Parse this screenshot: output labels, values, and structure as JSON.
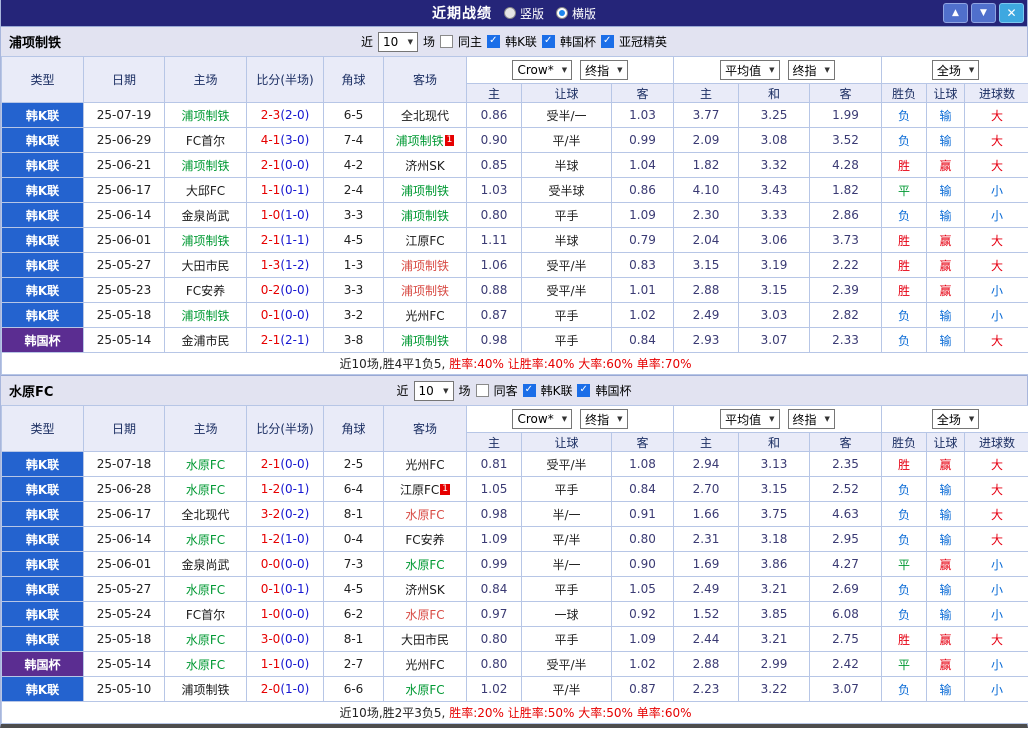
{
  "titlebar": {
    "title": "近期战绩",
    "radio_vertical": "竖版",
    "radio_horizontal": "横版",
    "up": "▲",
    "down": "▼",
    "close": "✕"
  },
  "columns": {
    "type": "类型",
    "date": "日期",
    "home": "主场",
    "score": "比分(半场)",
    "corner": "角球",
    "away": "客场",
    "sub": [
      "主",
      "让球",
      "客",
      "主",
      "和",
      "客",
      "胜负",
      "让球",
      "进球数"
    ]
  },
  "colors": {
    "accent_blue": "#2463cf",
    "cup_purple": "#5b2d91",
    "win_red": "#e60012",
    "loss_blue": "#0a6bd6",
    "draw_green": "#009933",
    "team_green": "#009933",
    "titlebar": "#252579"
  },
  "sections": [
    {
      "team": "浦项制铁",
      "filter": {
        "near": "近",
        "games": "10",
        "unit": "场",
        "same_label": "同主",
        "same_checked": false,
        "leagues": [
          {
            "label": "韩K联",
            "checked": true
          },
          {
            "label": "韩国杯",
            "checked": true
          },
          {
            "label": "亚冠精英",
            "checked": true
          }
        ]
      },
      "selects": {
        "bookmaker": "Crow*",
        "ah_index": "终指",
        "euro": "平均值",
        "euro_index": "终指",
        "scope": "全场"
      },
      "rows": [
        {
          "lg": "韩K联",
          "cup": false,
          "d": "25-07-19",
          "h": "浦项制铁",
          "hc": "green",
          "hcard": false,
          "s": "2-3",
          "hf": "(2-0)",
          "cn": "6-5",
          "a": "全北现代",
          "ac": "black",
          "acard": false,
          "o1": "0.86",
          "ol": "受半/一",
          "o2": "1.03",
          "e1": "3.77",
          "e2": "3.25",
          "e3": "1.99",
          "r": "负",
          "rc": "blue",
          "w": "输",
          "wc": "blue",
          "g": "大",
          "gc": "red"
        },
        {
          "lg": "韩K联",
          "cup": false,
          "d": "25-06-29",
          "h": "FC首尔",
          "hc": "black",
          "hcard": false,
          "s": "4-1",
          "hf": "(3-0)",
          "cn": "7-4",
          "a": "浦项制铁",
          "ac": "green",
          "acard": true,
          "o1": "0.90",
          "ol": "平/半",
          "o2": "0.99",
          "e1": "2.09",
          "e2": "3.08",
          "e3": "3.52",
          "r": "负",
          "rc": "blue",
          "w": "输",
          "wc": "blue",
          "g": "大",
          "gc": "red"
        },
        {
          "lg": "韩K联",
          "cup": false,
          "d": "25-06-21",
          "h": "浦项制铁",
          "hc": "green",
          "hcard": false,
          "s": "2-1",
          "hf": "(0-0)",
          "cn": "4-2",
          "a": "济州SK",
          "ac": "black",
          "acard": false,
          "o1": "0.85",
          "ol": "半球",
          "o2": "1.04",
          "e1": "1.82",
          "e2": "3.32",
          "e3": "4.28",
          "r": "胜",
          "rc": "red",
          "w": "赢",
          "wc": "red",
          "g": "大",
          "gc": "red"
        },
        {
          "lg": "韩K联",
          "cup": false,
          "d": "25-06-17",
          "h": "大邱FC",
          "hc": "black",
          "hcard": false,
          "s": "1-1",
          "hf": "(0-1)",
          "cn": "2-4",
          "a": "浦项制铁",
          "ac": "green",
          "acard": false,
          "o1": "1.03",
          "ol": "受半球",
          "o2": "0.86",
          "e1": "4.10",
          "e2": "3.43",
          "e3": "1.82",
          "r": "平",
          "rc": "green",
          "w": "输",
          "wc": "blue",
          "g": "小",
          "gc": "blue"
        },
        {
          "lg": "韩K联",
          "cup": false,
          "d": "25-06-14",
          "h": "金泉尚武",
          "hc": "black",
          "hcard": false,
          "s": "1-0",
          "hf": "(1-0)",
          "cn": "3-3",
          "a": "浦项制铁",
          "ac": "green",
          "acard": false,
          "o1": "0.80",
          "ol": "平手",
          "o2": "1.09",
          "e1": "2.30",
          "e2": "3.33",
          "e3": "2.86",
          "r": "负",
          "rc": "blue",
          "w": "输",
          "wc": "blue",
          "g": "小",
          "gc": "blue"
        },
        {
          "lg": "韩K联",
          "cup": false,
          "d": "25-06-01",
          "h": "浦项制铁",
          "hc": "green",
          "hcard": false,
          "s": "2-1",
          "hf": "(1-1)",
          "cn": "4-5",
          "a": "江原FC",
          "ac": "black",
          "acard": false,
          "o1": "1.11",
          "ol": "半球",
          "o2": "0.79",
          "e1": "2.04",
          "e2": "3.06",
          "e3": "3.73",
          "r": "胜",
          "rc": "red",
          "w": "赢",
          "wc": "red",
          "g": "大",
          "gc": "red"
        },
        {
          "lg": "韩K联",
          "cup": false,
          "d": "25-05-27",
          "h": "大田市民",
          "hc": "black",
          "hcard": false,
          "s": "1-3",
          "hf": "(1-2)",
          "cn": "1-3",
          "a": "浦项制铁",
          "ac": "red",
          "acard": false,
          "o1": "1.06",
          "ol": "受平/半",
          "o2": "0.83",
          "e1": "3.15",
          "e2": "3.19",
          "e3": "2.22",
          "r": "胜",
          "rc": "red",
          "w": "赢",
          "wc": "red",
          "g": "大",
          "gc": "red"
        },
        {
          "lg": "韩K联",
          "cup": false,
          "d": "25-05-23",
          "h": "FC安养",
          "hc": "black",
          "hcard": false,
          "s": "0-2",
          "hf": "(0-0)",
          "cn": "3-3",
          "a": "浦项制铁",
          "ac": "red",
          "acard": false,
          "o1": "0.88",
          "ol": "受平/半",
          "o2": "1.01",
          "e1": "2.88",
          "e2": "3.15",
          "e3": "2.39",
          "r": "胜",
          "rc": "red",
          "w": "赢",
          "wc": "red",
          "g": "小",
          "gc": "blue"
        },
        {
          "lg": "韩K联",
          "cup": false,
          "d": "25-05-18",
          "h": "浦项制铁",
          "hc": "green",
          "hcard": false,
          "s": "0-1",
          "hf": "(0-0)",
          "cn": "3-2",
          "a": "光州FC",
          "ac": "black",
          "acard": false,
          "o1": "0.87",
          "ol": "平手",
          "o2": "1.02",
          "e1": "2.49",
          "e2": "3.03",
          "e3": "2.82",
          "r": "负",
          "rc": "blue",
          "w": "输",
          "wc": "blue",
          "g": "小",
          "gc": "blue"
        },
        {
          "lg": "韩国杯",
          "cup": true,
          "d": "25-05-14",
          "h": "金浦市民",
          "hc": "black",
          "hcard": false,
          "s": "2-1",
          "hf": "(2-1)",
          "cn": "3-8",
          "a": "浦项制铁",
          "ac": "green",
          "acard": false,
          "o1": "0.98",
          "ol": "平手",
          "o2": "0.84",
          "e1": "2.93",
          "e2": "3.07",
          "e3": "2.33",
          "r": "负",
          "rc": "blue",
          "w": "输",
          "wc": "blue",
          "g": "大",
          "gc": "red"
        }
      ],
      "summary": {
        "plain": "近10场,胜4平1负5,",
        "red": "胜率:40% 让胜率:40% 大率:60% 单率:70%"
      }
    },
    {
      "team": "水原FC",
      "filter": {
        "near": "近",
        "games": "10",
        "unit": "场",
        "same_label": "同客",
        "same_checked": false,
        "leagues": [
          {
            "label": "韩K联",
            "checked": true
          },
          {
            "label": "韩国杯",
            "checked": true
          }
        ]
      },
      "selects": {
        "bookmaker": "Crow*",
        "ah_index": "终指",
        "euro": "平均值",
        "euro_index": "终指",
        "scope": "全场"
      },
      "rows": [
        {
          "lg": "韩K联",
          "cup": false,
          "d": "25-07-18",
          "h": "水原FC",
          "hc": "green",
          "hcard": false,
          "s": "2-1",
          "hf": "(0-0)",
          "cn": "2-5",
          "a": "光州FC",
          "ac": "black",
          "acard": false,
          "o1": "0.81",
          "ol": "受平/半",
          "o2": "1.08",
          "e1": "2.94",
          "e2": "3.13",
          "e3": "2.35",
          "r": "胜",
          "rc": "red",
          "w": "赢",
          "wc": "red",
          "g": "大",
          "gc": "red"
        },
        {
          "lg": "韩K联",
          "cup": false,
          "d": "25-06-28",
          "h": "水原FC",
          "hc": "green",
          "hcard": false,
          "s": "1-2",
          "hf": "(0-1)",
          "cn": "6-4",
          "a": "江原FC",
          "ac": "black",
          "acard": true,
          "o1": "1.05",
          "ol": "平手",
          "o2": "0.84",
          "e1": "2.70",
          "e2": "3.15",
          "e3": "2.52",
          "r": "负",
          "rc": "blue",
          "w": "输",
          "wc": "blue",
          "g": "大",
          "gc": "red"
        },
        {
          "lg": "韩K联",
          "cup": false,
          "d": "25-06-17",
          "h": "全北现代",
          "hc": "black",
          "hcard": false,
          "s": "3-2",
          "hf": "(0-2)",
          "cn": "8-1",
          "a": "水原FC",
          "ac": "red",
          "acard": false,
          "o1": "0.98",
          "ol": "半/一",
          "o2": "0.91",
          "e1": "1.66",
          "e2": "3.75",
          "e3": "4.63",
          "r": "负",
          "rc": "blue",
          "w": "输",
          "wc": "blue",
          "g": "大",
          "gc": "red"
        },
        {
          "lg": "韩K联",
          "cup": false,
          "d": "25-06-14",
          "h": "水原FC",
          "hc": "green",
          "hcard": false,
          "s": "1-2",
          "hf": "(1-0)",
          "cn": "0-4",
          "a": "FC安养",
          "ac": "black",
          "acard": false,
          "o1": "1.09",
          "ol": "平/半",
          "o2": "0.80",
          "e1": "2.31",
          "e2": "3.18",
          "e3": "2.95",
          "r": "负",
          "rc": "blue",
          "w": "输",
          "wc": "blue",
          "g": "大",
          "gc": "red"
        },
        {
          "lg": "韩K联",
          "cup": false,
          "d": "25-06-01",
          "h": "金泉尚武",
          "hc": "black",
          "hcard": false,
          "s": "0-0",
          "hf": "(0-0)",
          "cn": "7-3",
          "a": "水原FC",
          "ac": "green",
          "acard": false,
          "o1": "0.99",
          "ol": "半/一",
          "o2": "0.90",
          "e1": "1.69",
          "e2": "3.86",
          "e3": "4.27",
          "r": "平",
          "rc": "green",
          "w": "赢",
          "wc": "red",
          "g": "小",
          "gc": "blue"
        },
        {
          "lg": "韩K联",
          "cup": false,
          "d": "25-05-27",
          "h": "水原FC",
          "hc": "green",
          "hcard": false,
          "s": "0-1",
          "hf": "(0-1)",
          "cn": "4-5",
          "a": "济州SK",
          "ac": "black",
          "acard": false,
          "o1": "0.84",
          "ol": "平手",
          "o2": "1.05",
          "e1": "2.49",
          "e2": "3.21",
          "e3": "2.69",
          "r": "负",
          "rc": "blue",
          "w": "输",
          "wc": "blue",
          "g": "小",
          "gc": "blue"
        },
        {
          "lg": "韩K联",
          "cup": false,
          "d": "25-05-24",
          "h": "FC首尔",
          "hc": "black",
          "hcard": false,
          "s": "1-0",
          "hf": "(0-0)",
          "cn": "6-2",
          "a": "水原FC",
          "ac": "red",
          "acard": false,
          "o1": "0.97",
          "ol": "一球",
          "o2": "0.92",
          "e1": "1.52",
          "e2": "3.85",
          "e3": "6.08",
          "r": "负",
          "rc": "blue",
          "w": "输",
          "wc": "blue",
          "g": "小",
          "gc": "blue"
        },
        {
          "lg": "韩K联",
          "cup": false,
          "d": "25-05-18",
          "h": "水原FC",
          "hc": "green",
          "hcard": false,
          "s": "3-0",
          "hf": "(0-0)",
          "cn": "8-1",
          "a": "大田市民",
          "ac": "black",
          "acard": false,
          "o1": "0.80",
          "ol": "平手",
          "o2": "1.09",
          "e1": "2.44",
          "e2": "3.21",
          "e3": "2.75",
          "r": "胜",
          "rc": "red",
          "w": "赢",
          "wc": "red",
          "g": "大",
          "gc": "red"
        },
        {
          "lg": "韩国杯",
          "cup": true,
          "d": "25-05-14",
          "h": "水原FC",
          "hc": "green",
          "hcard": false,
          "s": "1-1",
          "hf": "(0-0)",
          "cn": "2-7",
          "a": "光州FC",
          "ac": "black",
          "acard": false,
          "o1": "0.80",
          "ol": "受平/半",
          "o2": "1.02",
          "e1": "2.88",
          "e2": "2.99",
          "e3": "2.42",
          "r": "平",
          "rc": "green",
          "w": "赢",
          "wc": "red",
          "g": "小",
          "gc": "blue"
        },
        {
          "lg": "韩K联",
          "cup": false,
          "d": "25-05-10",
          "h": "浦项制铁",
          "hc": "black",
          "hcard": false,
          "s": "2-0",
          "hf": "(1-0)",
          "cn": "6-6",
          "a": "水原FC",
          "ac": "green",
          "acard": false,
          "o1": "1.02",
          "ol": "平/半",
          "o2": "0.87",
          "e1": "2.23",
          "e2": "3.22",
          "e3": "3.07",
          "r": "负",
          "rc": "blue",
          "w": "输",
          "wc": "blue",
          "g": "小",
          "gc": "blue"
        }
      ],
      "summary": {
        "plain": "近10场,胜2平3负5,",
        "red": "胜率:20% 让胜率:50% 大率:50% 单率:60%"
      }
    }
  ]
}
